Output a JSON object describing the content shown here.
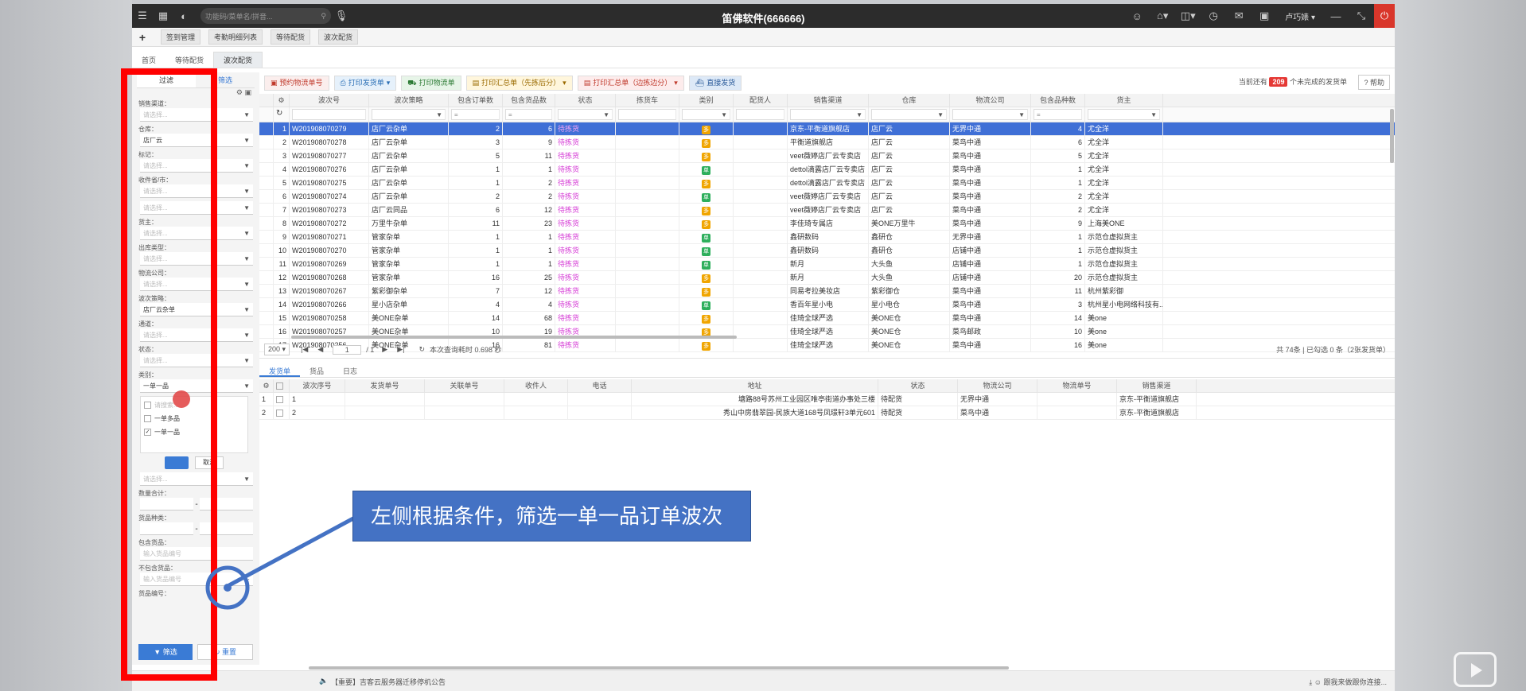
{
  "window": {
    "search_placeholder": "功能码/菜单名/拼音...",
    "title": "笛佛软件(666666)",
    "user": "卢巧婊"
  },
  "menu": [
    "签到管理",
    "考勤明细列表",
    "等待配货",
    "波次配货"
  ],
  "page_tabs": [
    "首页",
    "等待配货",
    "波次配货"
  ],
  "filter_panel": {
    "tab_filter": "过滤",
    "tab_screen": "筛选",
    "placeholder": "请选择...",
    "fields": [
      {
        "label": "销售渠道：",
        "value": ""
      },
      {
        "label": "仓库：",
        "value": "店厂云"
      },
      {
        "label": "标记：",
        "value": ""
      },
      {
        "label": "收件省/市：",
        "value": ""
      },
      {
        "label": "",
        "value": ""
      },
      {
        "label": "货主：",
        "value": ""
      },
      {
        "label": "出库类型：",
        "value": ""
      },
      {
        "label": "物流公司：",
        "value": ""
      },
      {
        "label": "波次策略：",
        "value": "店厂云杂单"
      },
      {
        "label": "通道：",
        "value": ""
      },
      {
        "label": "状态：",
        "value": ""
      }
    ],
    "category_label": "类别：",
    "category_value": "一单一品",
    "dropdown": {
      "search_placeholder": "请搜索...",
      "options": [
        "一单多品",
        "一单一品"
      ],
      "cancel": "取消"
    },
    "qty_label": "数量合计：",
    "kinds_label": "货品种类：",
    "include_label": "包含货品：",
    "include_placeholder": "输入货品编号",
    "exclude_label": "不包含货品：",
    "exclude_placeholder": "输入货品编号",
    "code_label": "货品编号：",
    "filter_button": "筛选",
    "reset_button": "重置"
  },
  "toolbar": {
    "buttons": [
      "预约物流单号",
      "打印发货单",
      "打印物流单",
      "打印汇总单（先拣后分）",
      "打印汇总单（边拣边分）",
      "直接发货"
    ],
    "pending_prefix": "当前还有",
    "pending_count": "209",
    "pending_suffix": "个未完成的发货单",
    "help": "帮助"
  },
  "grid": {
    "columns": [
      "",
      "",
      "波次号",
      "波次策略",
      "包含订单数",
      "包含货品数",
      "状态",
      "拣货车",
      "类别",
      "配货人",
      "销售渠道",
      "仓库",
      "物流公司",
      "包含品种数",
      "货主"
    ],
    "rows": [
      [
        "1",
        "W201908070279",
        "店厂云杂单",
        "2",
        "6",
        "待拣货",
        "",
        "多",
        "",
        "京东-平衡道旗舰店",
        "店厂云",
        "无界中通",
        "4",
        "尤全洋"
      ],
      [
        "2",
        "W201908070278",
        "店厂云杂单",
        "3",
        "9",
        "待拣货",
        "",
        "多",
        "",
        "平衡道旗舰店",
        "店厂云",
        "菜鸟中通",
        "6",
        "尤全洋"
      ],
      [
        "3",
        "W201908070277",
        "店厂云杂单",
        "5",
        "11",
        "待拣货",
        "",
        "多",
        "",
        "veet薇婷店厂云专卖店",
        "店厂云",
        "菜鸟中通",
        "5",
        "尤全洋"
      ],
      [
        "4",
        "W201908070276",
        "店厂云杂单",
        "1",
        "1",
        "待拣货",
        "",
        "单",
        "",
        "dettol滴露店厂云专卖店",
        "店厂云",
        "菜鸟中通",
        "1",
        "尤全洋"
      ],
      [
        "5",
        "W201908070275",
        "店厂云杂单",
        "1",
        "2",
        "待拣货",
        "",
        "多",
        "",
        "dettol滴露店厂云专卖店",
        "店厂云",
        "菜鸟中通",
        "1",
        "尤全洋"
      ],
      [
        "6",
        "W201908070274",
        "店厂云杂单",
        "2",
        "2",
        "待拣货",
        "",
        "单",
        "",
        "veet薇婷店厂云专卖店",
        "店厂云",
        "菜鸟中通",
        "2",
        "尤全洋"
      ],
      [
        "7",
        "W201908070273",
        "店厂云同品",
        "6",
        "12",
        "待拣货",
        "",
        "多",
        "",
        "veet薇婷店厂云专卖店",
        "店厂云",
        "菜鸟中通",
        "2",
        "尤全洋"
      ],
      [
        "8",
        "W201908070272",
        "万里牛杂单",
        "11",
        "23",
        "待拣货",
        "",
        "多",
        "",
        "李佳琦专属店",
        "美ONE万里牛",
        "菜鸟中通",
        "9",
        "上海美ONE"
      ],
      [
        "9",
        "W201908070271",
        "管家杂单",
        "1",
        "1",
        "待拣货",
        "",
        "单",
        "",
        "鑫研数码",
        "鑫研仓",
        "无界中通",
        "1",
        "示范仓虚拟货主"
      ],
      [
        "10",
        "W201908070270",
        "管家杂单",
        "1",
        "1",
        "待拣货",
        "",
        "单",
        "",
        "鑫研数码",
        "鑫研仓",
        "店铺中通",
        "1",
        "示范仓虚拟货主"
      ],
      [
        "11",
        "W201908070269",
        "管家杂单",
        "1",
        "1",
        "待拣货",
        "",
        "单",
        "",
        "新月",
        "大头鱼",
        "店铺中通",
        "1",
        "示范仓虚拟货主"
      ],
      [
        "12",
        "W201908070268",
        "管家杂单",
        "16",
        "25",
        "待拣货",
        "",
        "多",
        "",
        "新月",
        "大头鱼",
        "店铺中通",
        "20",
        "示范仓虚拟货主"
      ],
      [
        "13",
        "W201908070267",
        "紫彩御杂单",
        "7",
        "12",
        "待拣货",
        "",
        "多",
        "",
        "同易考拉美妆店",
        "紫彩御仓",
        "菜鸟中通",
        "11",
        "杭州紫彩御"
      ],
      [
        "14",
        "W201908070266",
        "星小店杂单",
        "4",
        "4",
        "待拣货",
        "",
        "单",
        "",
        "香百年星小电",
        "星小电仓",
        "菜鸟中通",
        "3",
        "杭州星小电网络科技有..."
      ],
      [
        "15",
        "W201908070258",
        "美ONE杂单",
        "14",
        "68",
        "待拣货",
        "",
        "多",
        "",
        "佳琦全球严选",
        "美ONE仓",
        "菜鸟中通",
        "14",
        "美one"
      ],
      [
        "16",
        "W201908070257",
        "美ONE杂单",
        "10",
        "19",
        "待拣货",
        "",
        "多",
        "",
        "佳琦全球严选",
        "美ONE仓",
        "菜鸟邮政",
        "10",
        "美one"
      ],
      [
        "17",
        "W201908070256",
        "美ONE杂单",
        "16",
        "81",
        "待拣货",
        "",
        "多",
        "",
        "佳琦全球严选",
        "美ONE仓",
        "菜鸟中通",
        "16",
        "美one"
      ]
    ]
  },
  "pager": {
    "page_size": "200",
    "page": "1",
    "total_pages": "/ 1",
    "query_time": "本次查询耗时 0.698 秒",
    "summary": "共 74条 | 已勾选 0 条（2张发货单）"
  },
  "bottom_tabs": [
    "发货单",
    "货品",
    "日志"
  ],
  "detail": {
    "columns": [
      "",
      "",
      "波次序号",
      "发货单号",
      "关联单号",
      "收件人",
      "电话",
      "地址",
      "状态",
      "物流公司",
      "物流单号",
      "销售渠道"
    ],
    "rows": [
      [
        "1",
        "1",
        "",
        "",
        "",
        "",
        "塘路88号苏州工业园区唯亭街道办事处三楼",
        "待配货",
        "无界中通",
        "",
        "京东-平衡道旗舰店"
      ],
      [
        "2",
        "2",
        "",
        "",
        "",
        "",
        "秀山中房翡翠园-民族大道168号凤璟轩3单元601",
        "待配货",
        "菜鸟中通",
        "",
        "京东-平衡道旗舰店"
      ]
    ]
  },
  "callout": "左侧根据条件，筛选一单一品订单波次",
  "status": {
    "notice": "【重要】吉客云服务器迁移停机公告",
    "right": "跟我来做跟你连接..."
  }
}
